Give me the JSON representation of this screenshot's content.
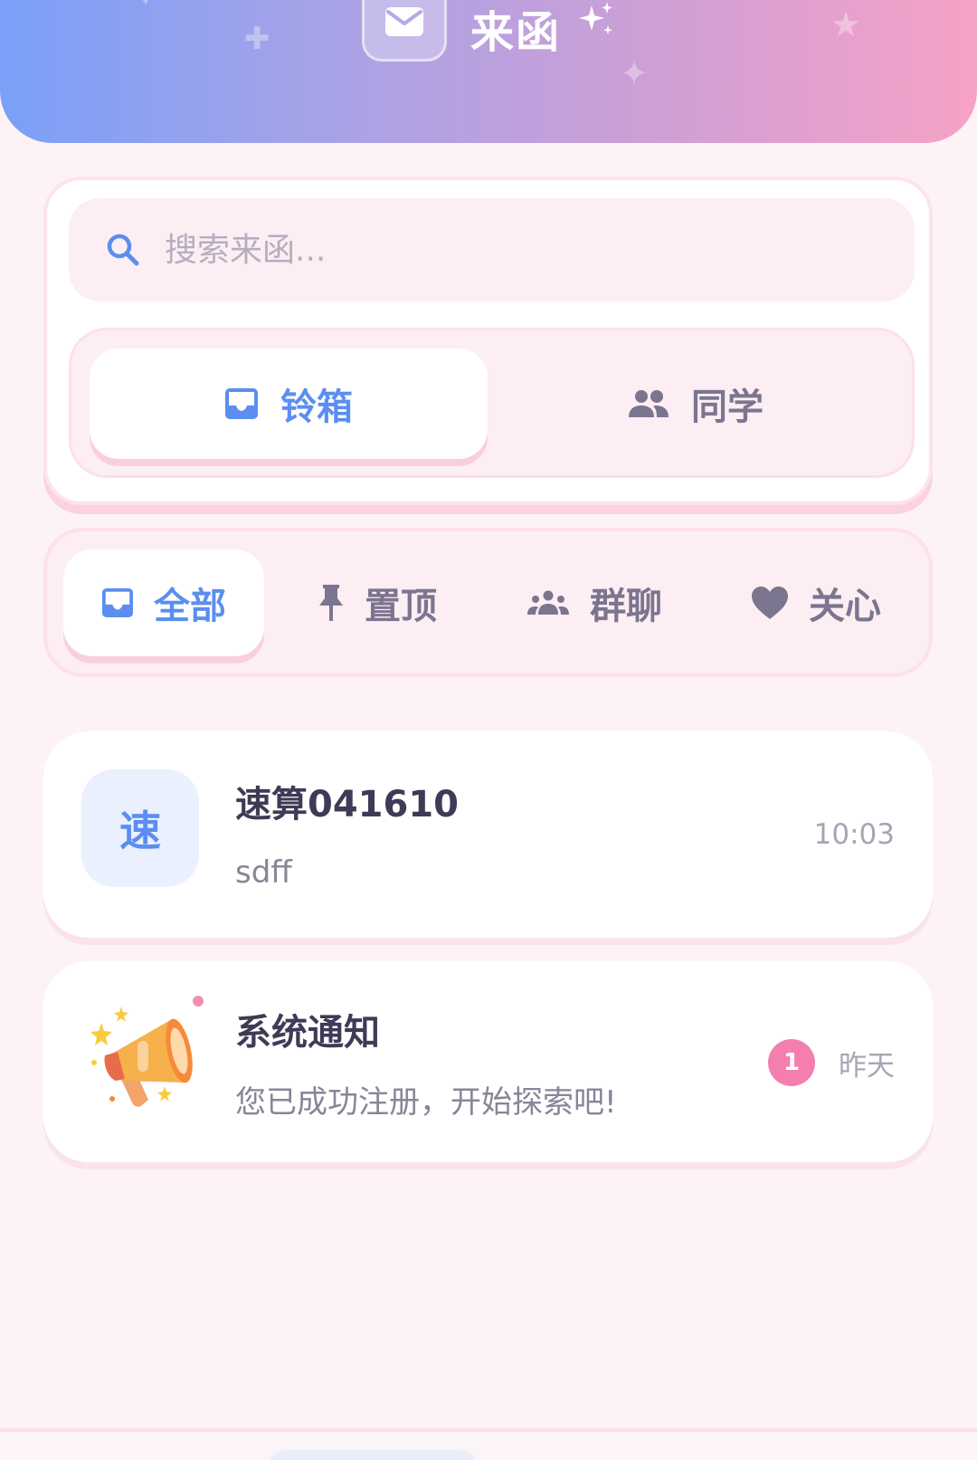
{
  "header": {
    "title": "来函",
    "icon": "mail-icon"
  },
  "search": {
    "placeholder": "搜索来函...",
    "value": ""
  },
  "segments": [
    {
      "label": "铃箱",
      "icon": "inbox-icon",
      "active": true
    },
    {
      "label": "同学",
      "icon": "people-icon",
      "active": false
    }
  ],
  "filters": [
    {
      "label": "全部",
      "icon": "inbox-icon",
      "active": true
    },
    {
      "label": "置顶",
      "icon": "pin-icon",
      "active": false
    },
    {
      "label": "群聊",
      "icon": "group-icon",
      "active": false
    },
    {
      "label": "关心",
      "icon": "heart-icon",
      "active": false
    }
  ],
  "messages": [
    {
      "avatar_text": "速",
      "title": "速算041610",
      "preview": "sdff",
      "time": "10:03"
    },
    {
      "avatar_icon": "megaphone-icon",
      "title": "系统通知",
      "preview": "您已成功注册，开始探索吧!",
      "time": "昨天",
      "unread": "1"
    }
  ],
  "colors": {
    "accent": "#5b8ef0",
    "badge": "#f47fae",
    "background": "#fdf3f6"
  }
}
